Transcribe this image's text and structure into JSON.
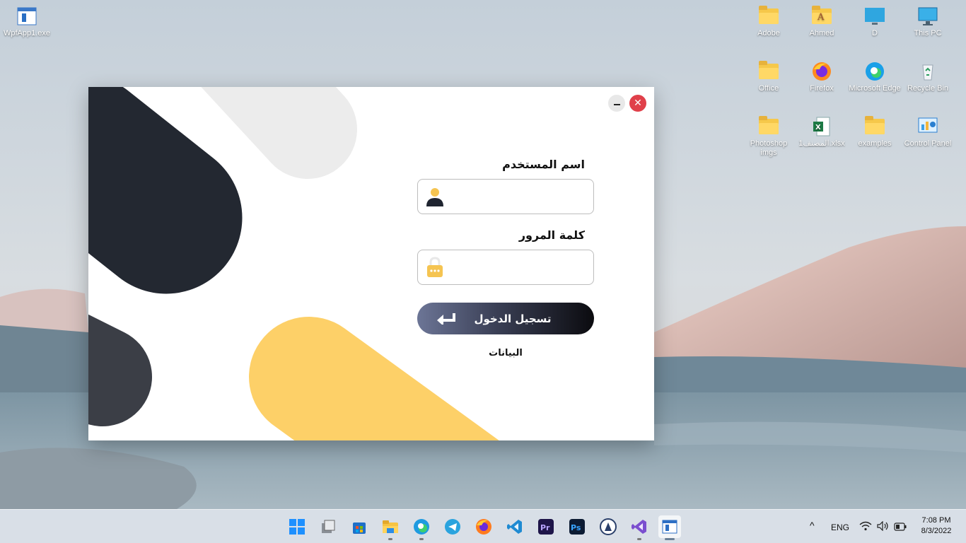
{
  "desktop": {
    "icons": [
      {
        "label": "WpfApp1.exe"
      },
      {
        "label": "Adobe"
      },
      {
        "label": "Ahmed"
      },
      {
        "label": "D"
      },
      {
        "label": "This PC"
      },
      {
        "label": "Office"
      },
      {
        "label": "Firefox"
      },
      {
        "label": "Microsoft Edge"
      },
      {
        "label": "Recycle Bin"
      },
      {
        "label": "Photoshop imgs"
      },
      {
        "label": "المصنف1.xlsx"
      },
      {
        "label": "examples"
      },
      {
        "label": "Control Panel"
      }
    ]
  },
  "login_window": {
    "username_label": "اسم المستخدم",
    "username_value": "",
    "password_label": "كلمة المرور",
    "password_value": "",
    "login_button": "تسجيل الدخول",
    "data_link": "البيانات",
    "close_glyph": "✕",
    "colors": {
      "dark": "#232831",
      "gray": "#3b3e46",
      "light": "#ececec",
      "yellow": "#fdd068",
      "close": "#e0404a"
    }
  },
  "taskbar": {
    "apps": [
      "start-icon",
      "task-view-icon",
      "store-icon",
      "file-explorer-icon",
      "edge-icon",
      "telegram-icon",
      "firefox-icon",
      "vscode-icon",
      "premiere-icon",
      "photoshop-icon",
      "inkscape-icon",
      "visual-studio-icon",
      "wpf-app-icon"
    ],
    "tray": {
      "chevron": "^",
      "language": "ENG",
      "time": "7:08 PM",
      "date": "8/3/2022"
    }
  }
}
